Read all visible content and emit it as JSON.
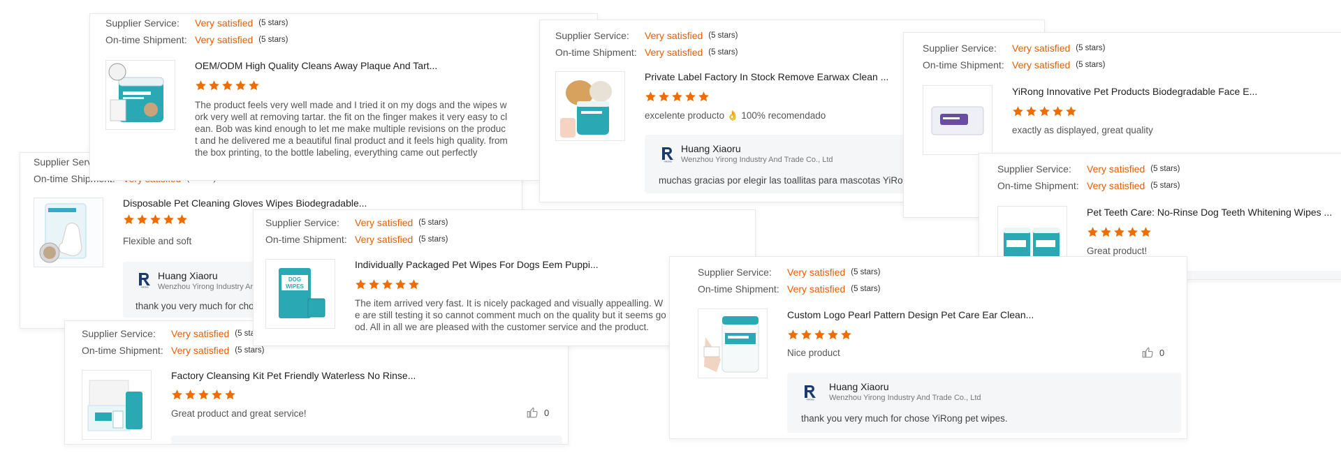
{
  "colors": {
    "accent": "#e85d04",
    "star": "#ef6c00",
    "border": "#e8e8e8",
    "reply_bg": "#f5f6f8",
    "teal": "#2aa9b4"
  },
  "labels": {
    "supplier_service": "Supplier Service:",
    "on_time_shipment": "On-time Shipment:",
    "very_satisfied": "Very satisfied",
    "five_stars": "(5 stars)"
  },
  "reviews": [
    {
      "product_title": "OEM/ODM High Quality Cleans Away Plaque And Tart...",
      "rating": 5,
      "text": "The product feels very well made and I tried it on my dogs and the wipes work very well at removing tartar. the fit on the finger makes it very easy to clean. Bob was kind enough to let me make multiple revisions on the product and he delivered me a beautiful final product and it feels high quality. from the box printing, to the bottle labeling, everything came out perfectly"
    },
    {
      "product_title": "Private Label Factory In Stock Remove Earwax Clean ...",
      "rating": 5,
      "text": "excelente producto 👌 100% recomendado",
      "reply": {
        "name": "Huang Xiaoru",
        "company": "Wenzhou Yirong Industry And Trade Co., Ltd",
        "message": "muchas gracias por elegir las toallitas para mascotas YiRong"
      }
    },
    {
      "product_title": "YiRong Innovative Pet Products Biodegradable Face E...",
      "rating": 5,
      "text": "exactly as displayed, great quality"
    },
    {
      "product_title": "Pet Teeth Care: No-Rinse Dog Teeth Whitening Wipes ...",
      "rating": 5,
      "text": "Great product!"
    },
    {
      "product_title": "Disposable Pet Cleaning Gloves Wipes Biodegradable...",
      "rating": 5,
      "text": "Flexible and soft",
      "reply": {
        "name": "Huang Xiaoru",
        "company": "Wenzhou Yirong Industry And Trade Co., Ltd",
        "message": "thank you very much for chose YiRong pet wipes."
      }
    },
    {
      "product_title": "Individually Packaged Pet Wipes For Dogs Eem Puppi...",
      "rating": 5,
      "text": "The item arrived very fast. It is nicely packaged and visually appealling. We are still testing it so cannot comment much on the quality but it seems good. All in all we are pleased with the customer service and the product."
    },
    {
      "product_title": "Factory Cleansing Kit Pet Friendly Waterless No Rinse...",
      "rating": 5,
      "text": "Great product and great service!",
      "likes": "0"
    },
    {
      "product_title": "Custom Logo Pearl Pattern Design Pet Care Ear Clean...",
      "rating": 5,
      "text": "Nice product",
      "likes": "0",
      "reply": {
        "name": "Huang Xiaoru",
        "company": "Wenzhou Yirong Industry And Trade Co., Ltd",
        "message": "thank you very much for chose  YiRong pet wipes."
      }
    }
  ]
}
